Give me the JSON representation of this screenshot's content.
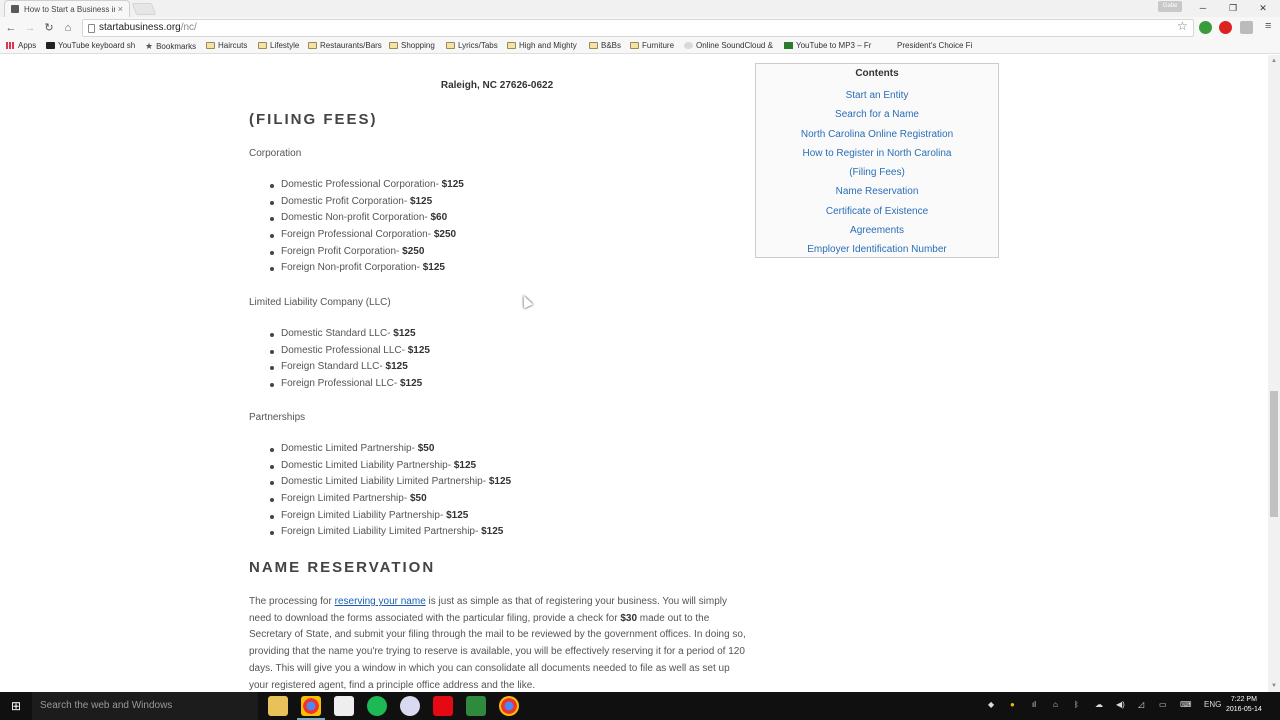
{
  "browser": {
    "tab_title": "How to Start a Business in",
    "tab_close": "×",
    "url_host": "startabusiness.org",
    "url_path": "/nc/",
    "user_badge": "Gabe"
  },
  "bookmarks": [
    {
      "label": "Apps",
      "icon": "apps-icon"
    },
    {
      "label": "YouTube keyboard sh",
      "icon": "youtube-icon"
    },
    {
      "label": "Bookmarks",
      "icon": "star-icon"
    },
    {
      "label": "Haircuts",
      "icon": "folder-icon"
    },
    {
      "label": "Lifestyle",
      "icon": "folder-icon"
    },
    {
      "label": "Restaurants/Bars",
      "icon": "folder-icon"
    },
    {
      "label": "Shopping",
      "icon": "folder-icon"
    },
    {
      "label": "Lyrics/Tabs",
      "icon": "folder-icon"
    },
    {
      "label": "High and Mighty",
      "icon": "folder-icon"
    },
    {
      "label": "B&Bs",
      "icon": "folder-icon"
    },
    {
      "label": "Furniture",
      "icon": "folder-icon"
    },
    {
      "label": "Online SoundCloud &",
      "icon": "soundcloud-icon"
    },
    {
      "label": "YouTube to MP3 – Fr",
      "icon": "download-icon"
    },
    {
      "label": "President's Choice Fi",
      "icon": "page-icon"
    }
  ],
  "content": {
    "address": "Raleigh, NC 27626-0622",
    "filing_fees_heading": "(FILING FEES)",
    "corporation": {
      "label": "Corporation",
      "items": [
        {
          "name": "Domestic Professional Corporation- ",
          "fee": "$125"
        },
        {
          "name": "Domestic Profit Corporation- ",
          "fee": "$125"
        },
        {
          "name": "Domestic Non-profit Corporation- ",
          "fee": "$60"
        },
        {
          "name": "Foreign Professional Corporation- ",
          "fee": "$250"
        },
        {
          "name": "Foreign Profit Corporation- ",
          "fee": "$250"
        },
        {
          "name": "Foreign Non-profit Corporation- ",
          "fee": "$125"
        }
      ]
    },
    "llc": {
      "label": "Limited Liability Company (LLC)",
      "items": [
        {
          "name": "Domestic Standard LLC- ",
          "fee": "$125"
        },
        {
          "name": "Domestic Professional LLC- ",
          "fee": "$125"
        },
        {
          "name": "Foreign Standard LLC- ",
          "fee": "$125"
        },
        {
          "name": "Foreign Professional LLC- ",
          "fee": "$125"
        }
      ]
    },
    "partnerships": {
      "label": "Partnerships",
      "items": [
        {
          "name": "Domestic Limited Partnership- ",
          "fee": "$50"
        },
        {
          "name": "Domestic Limited Liability Partnership- ",
          "fee": "$125"
        },
        {
          "name": "Domestic Limited Liability Limited Partnership- ",
          "fee": "$125"
        },
        {
          "name": "Foreign Limited Partnership- ",
          "fee": "$50"
        },
        {
          "name": "Foreign Limited Liability Partnership- ",
          "fee": "$125"
        },
        {
          "name": "Foreign Limited Liability Limited Partnership- ",
          "fee": "$125"
        }
      ]
    },
    "name_reservation_heading": "NAME RESERVATION",
    "name_reservation": {
      "p1": "The processing for ",
      "link": "reserving your name",
      "p2": " is just as simple as that of registering your business. You will simply need to download the forms associated with the particular filing, provide a check for ",
      "amount": "$30",
      "p3": " made out to the Secretary of State, and submit your filing through the mail to be reviewed by the government offices. In doing so, providing that the name you're trying to reserve is available, you will be effectively reserving it for a period of 120 days. This will give you a window in which you can consolidate all documents needed to file as well as set up your registered agent, find a principle office address and the like."
    }
  },
  "toc": {
    "title": "Contents",
    "items": [
      "Start an Entity",
      "Search for a Name",
      "North Carolina Online Registration",
      "How to Register in North Carolina",
      "(Filing Fees)",
      "Name Reservation",
      "Certificate of Existence",
      "Agreements",
      "Employer Identification Number"
    ]
  },
  "taskbar": {
    "search_placeholder": "Search the web and Windows",
    "language": "ENG",
    "time": "7:22 PM",
    "date": "2016-05-14"
  }
}
